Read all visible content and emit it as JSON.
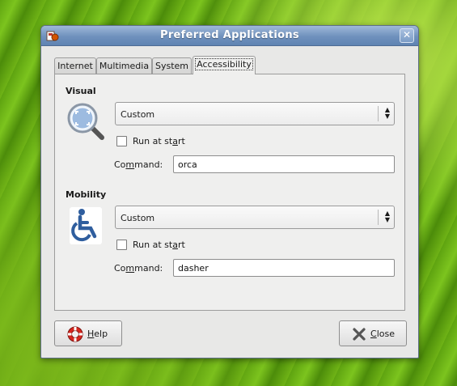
{
  "window": {
    "title": "Preferred Applications"
  },
  "tabs": [
    {
      "label": "Internet"
    },
    {
      "label": "Multimedia"
    },
    {
      "label": "System"
    },
    {
      "label": "Accessibility"
    }
  ],
  "visual": {
    "heading": "Visual",
    "icon": "magnifier-icon",
    "combo_value": "Custom",
    "run_at_start_label_pre": "Run at st",
    "run_at_start_label_mn": "a",
    "run_at_start_label_post": "rt",
    "run_at_start_checked": false,
    "command_label_pre": "Co",
    "command_label_mn": "m",
    "command_label_post": "mand:",
    "command_value": "orca"
  },
  "mobility": {
    "heading": "Mobility",
    "icon": "wheelchair-icon",
    "combo_value": "Custom",
    "run_at_start_label_pre": "Run at st",
    "run_at_start_label_mn": "a",
    "run_at_start_label_post": "rt",
    "run_at_start_checked": false,
    "command_label_pre": "Co",
    "command_label_mn": "m",
    "command_label_post": "mand:",
    "command_value": "dasher"
  },
  "buttons": {
    "help_mn": "H",
    "help_rest": "elp",
    "close_mn": "C",
    "close_rest": "lose"
  },
  "colors": {
    "titlebar": "#6f91bd",
    "desktop": "#6aab14"
  }
}
